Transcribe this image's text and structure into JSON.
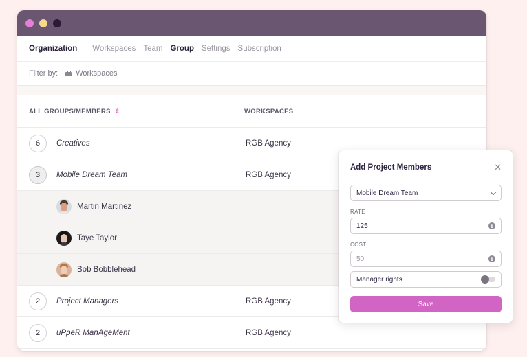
{
  "window": {
    "traffic_lights": [
      {
        "name": "close",
        "color": "#e77fd9"
      },
      {
        "name": "minimize",
        "color": "#f7d98a"
      },
      {
        "name": "maximize",
        "color": "#2e1737"
      }
    ]
  },
  "nav": {
    "title": "Organization",
    "tabs": [
      {
        "label": "Workspaces",
        "active": false
      },
      {
        "label": "Team",
        "active": false
      },
      {
        "label": "Group",
        "active": true
      },
      {
        "label": "Settings",
        "active": false
      },
      {
        "label": "Subscription",
        "active": false
      }
    ]
  },
  "filter": {
    "label": "Filter by:",
    "icon": "briefcase-icon",
    "value": "Workspaces"
  },
  "table": {
    "columns": {
      "groups": "ALL GROUPS/MEMBERS",
      "groups_sort_icon": "sort-icon",
      "workspaces": "WORKSPACES"
    },
    "rows": [
      {
        "type": "group",
        "count": "6",
        "name": "Creatives",
        "workspace": "RGB Agency",
        "selected": false
      },
      {
        "type": "group",
        "count": "3",
        "name": "Mobile Dream Team",
        "workspace": "RGB Agency",
        "selected": true
      },
      {
        "type": "member",
        "name": "Martin Martinez",
        "avatar": "avatar-martin"
      },
      {
        "type": "member",
        "name": "Taye Taylor",
        "avatar": "avatar-taye"
      },
      {
        "type": "member",
        "name": "Bob Bobblehead",
        "avatar": "avatar-bob"
      },
      {
        "type": "group",
        "count": "2",
        "name": "Project Managers",
        "workspace": "RGB Agency",
        "selected": false
      },
      {
        "type": "group",
        "count": "2",
        "name": "uPpeR ManAgeMent",
        "workspace": "RGB Agency",
        "selected": false
      }
    ]
  },
  "popover": {
    "title": "Add Project Members",
    "close_icon": "close-icon",
    "group_select": {
      "value": "Mobile Dream Team"
    },
    "rate": {
      "label": "RATE",
      "value": "125"
    },
    "cost": {
      "label": "COST",
      "placeholder": "50"
    },
    "manager_rights": {
      "label": "Manager rights",
      "enabled": false
    },
    "save_label": "Save"
  },
  "colors": {
    "titlebar": "#6a5670",
    "accent": "#d265c4",
    "background": "#fdf0ee"
  }
}
